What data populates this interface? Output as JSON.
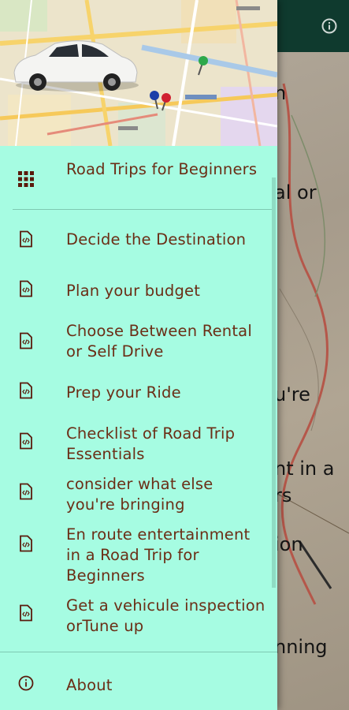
{
  "app": {
    "info_icon": "info-circle-icon",
    "background_fragments": [
      "n",
      "al or",
      "u're",
      "nt in a",
      "rs",
      "ion",
      "nning"
    ]
  },
  "drawer": {
    "header_image": "map-with-toy-car",
    "items": [
      {
        "label": "Road Trips for Beginners",
        "icon": "grid-icon"
      },
      {
        "label": "Decide the Destination",
        "icon": "code-file-icon"
      },
      {
        "label": "Plan your budget",
        "icon": "code-file-icon"
      },
      {
        "label": "Choose Between Rental or Self Drive",
        "icon": "code-file-icon"
      },
      {
        "label": "Prep your Ride",
        "icon": "code-file-icon"
      },
      {
        "label": "Checklist of Road Trip Essentials",
        "icon": "code-file-icon"
      },
      {
        "label": "consider what else you're bringing",
        "icon": "code-file-icon"
      },
      {
        "label": "En route entertainment in a Road Trip for Beginners",
        "icon": "code-file-icon"
      },
      {
        "label": "Get a vehicule inspection orTune up",
        "icon": "code-file-icon"
      },
      {
        "label": "About",
        "icon": "info-circle-icon"
      }
    ]
  },
  "colors": {
    "drawer_bg": "#a6fce2",
    "text": "#6b2e16",
    "toolbar": "#0f3a2e"
  }
}
